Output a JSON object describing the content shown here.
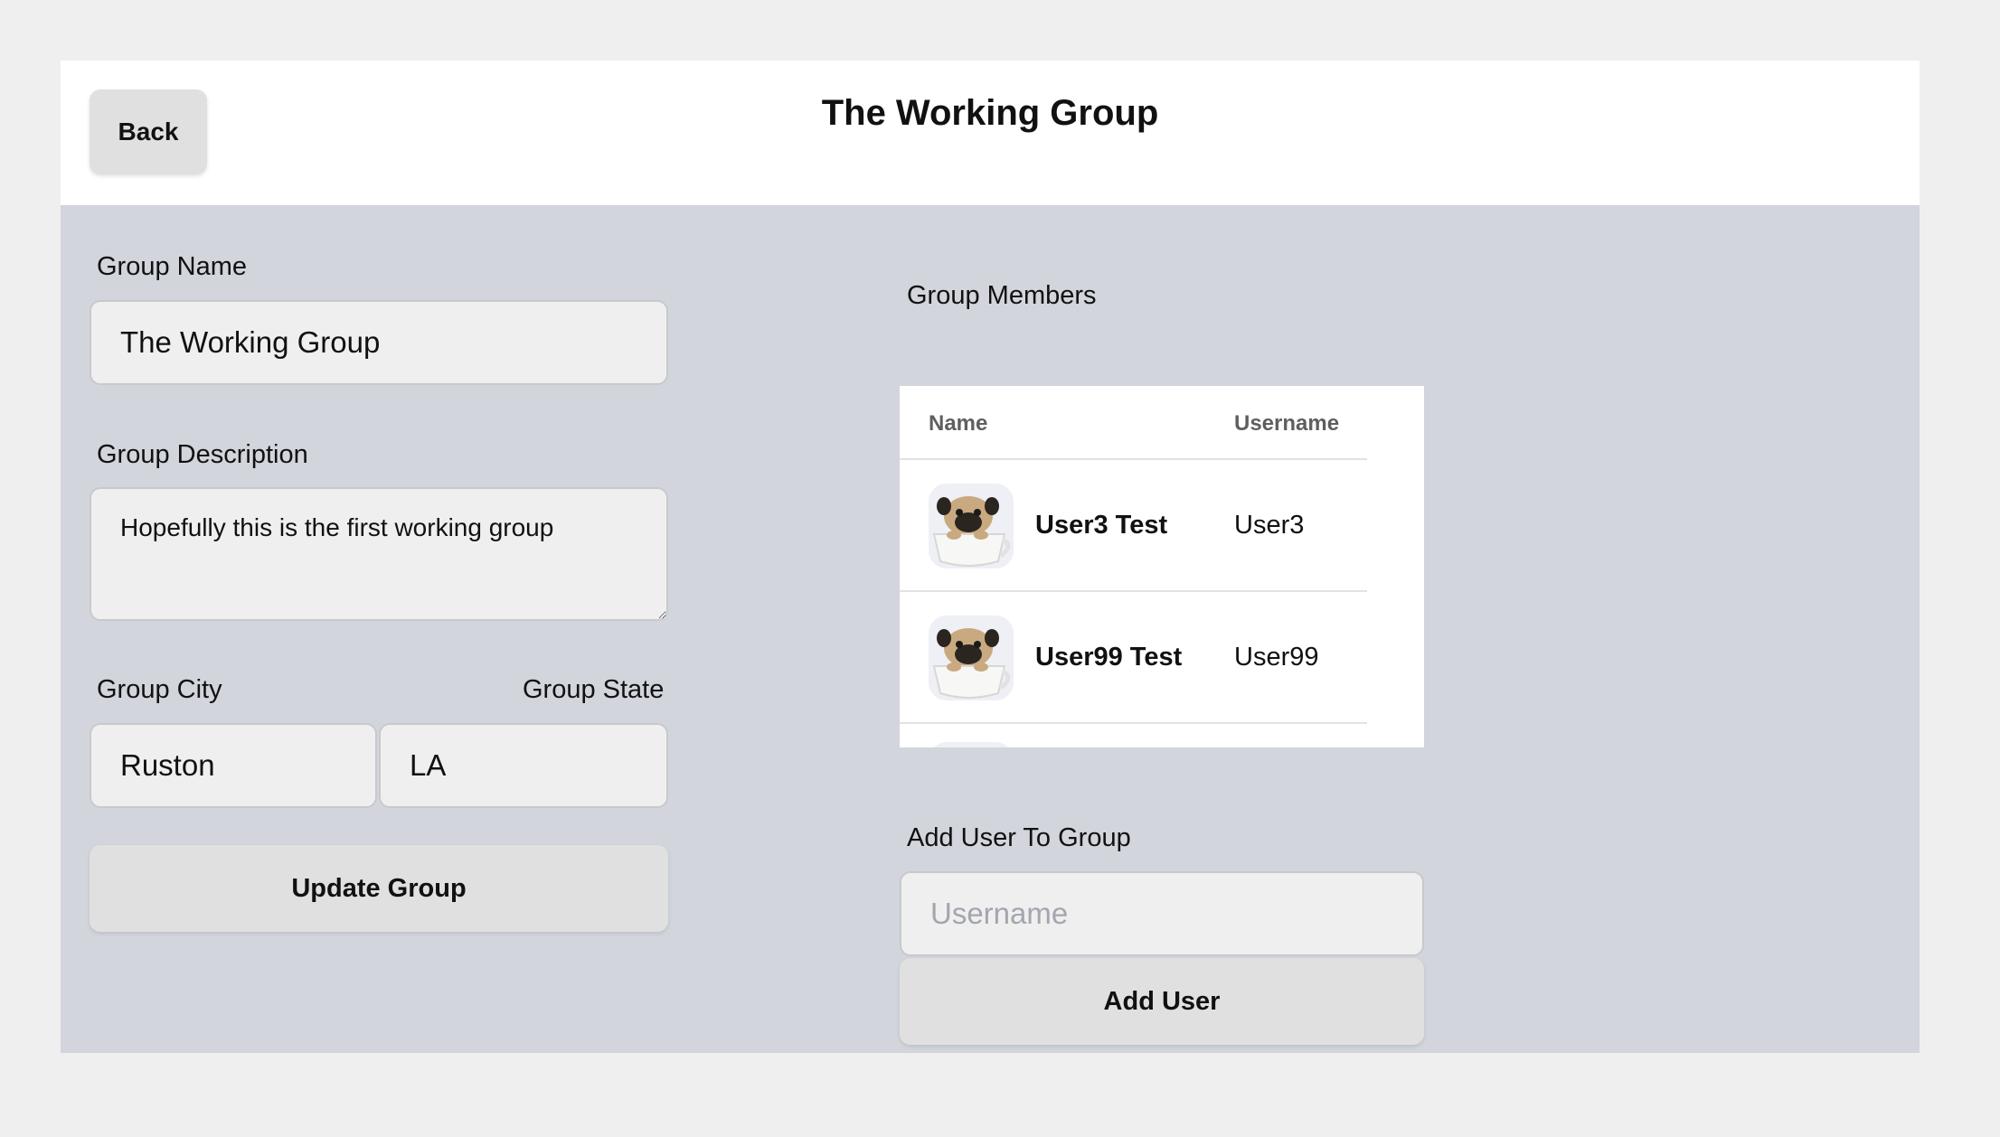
{
  "header": {
    "back_label": "Back",
    "title": "The Working Group"
  },
  "form": {
    "group_name_label": "Group Name",
    "group_name_value": "The Working Group",
    "group_description_label": "Group Description",
    "group_description_value": "Hopefully this is the first working group",
    "group_city_label": "Group City",
    "group_city_value": "Ruston",
    "group_state_label": "Group State",
    "group_state_value": "LA",
    "update_button_label": "Update Group"
  },
  "members": {
    "section_label": "Group Members",
    "columns": {
      "name": "Name",
      "username": "Username"
    },
    "rows": [
      {
        "name": "User3 Test",
        "username": "User3",
        "avatar": "pug-in-teacup-avatar"
      },
      {
        "name": "User99 Test",
        "username": "User99",
        "avatar": "pug-in-teacup-avatar"
      }
    ]
  },
  "add_user": {
    "section_label": "Add User To Group",
    "username_placeholder": "Username",
    "username_value": "",
    "button_label": "Add User"
  }
}
